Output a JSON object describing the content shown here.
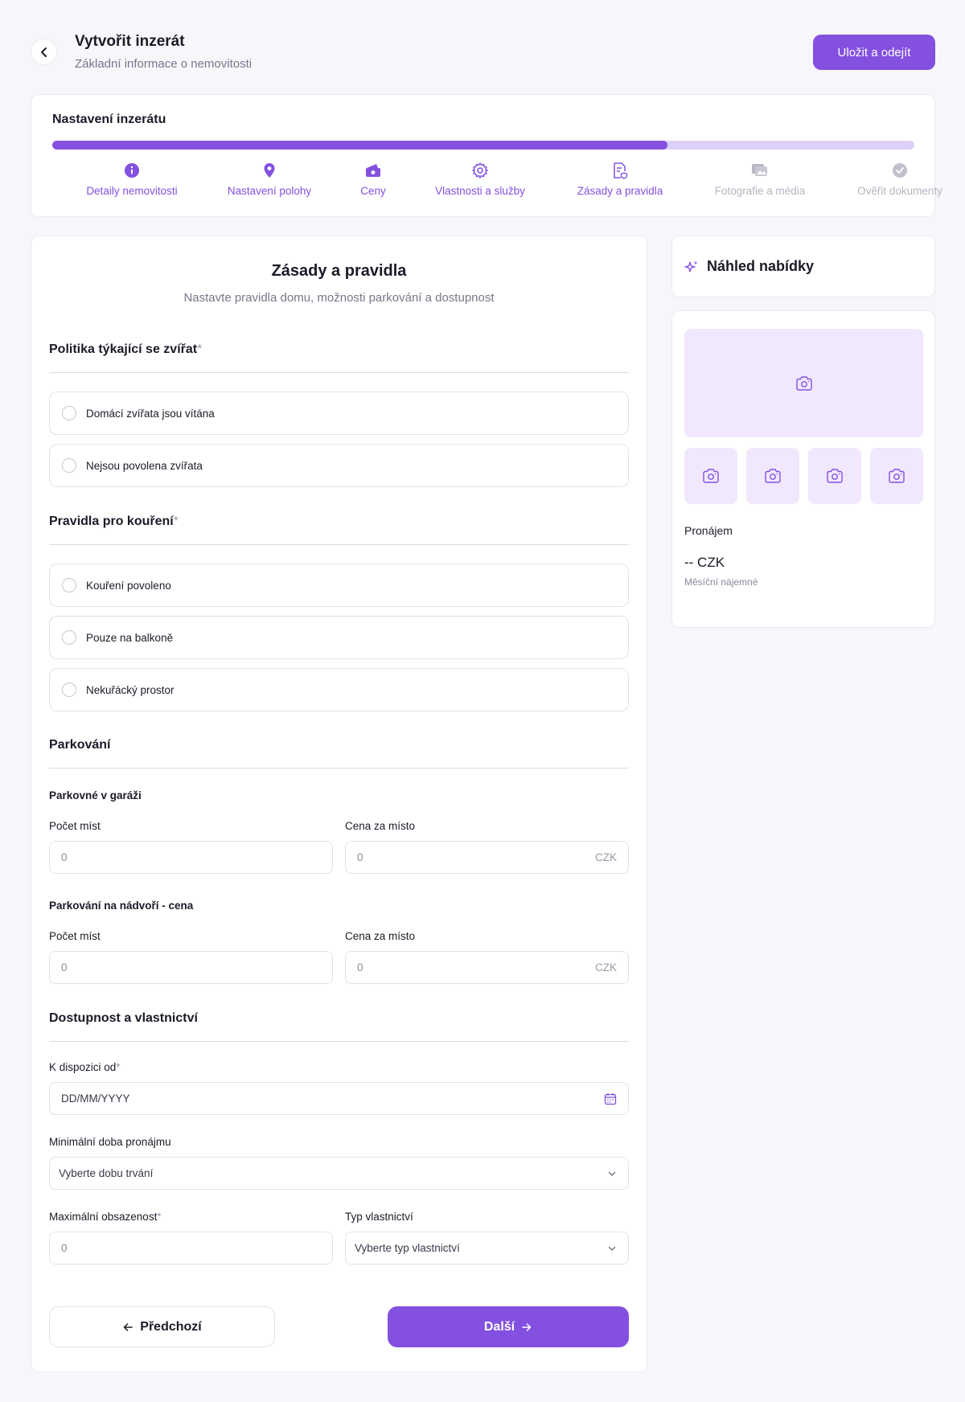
{
  "header": {
    "title": "Vytvořit inzerát",
    "subtitle": "Základní informace o nemovitosti",
    "save_label": "Uložit a odejít"
  },
  "progress": {
    "title": "Nastavení inzerátu",
    "fraction": 0.714,
    "steps": [
      {
        "label": "Detaily nemovitosti",
        "icon": "info-icon",
        "state": "done"
      },
      {
        "label": "Nastavení polohy",
        "icon": "location-pin-icon",
        "state": "done"
      },
      {
        "label": "Ceny",
        "icon": "wallet-icon",
        "state": "done"
      },
      {
        "label": "Vlastnosti a služby",
        "icon": "gear-icon",
        "state": "done"
      },
      {
        "label": "Zásady a pravidla",
        "icon": "rules-document-icon",
        "state": "active"
      },
      {
        "label": "Fotografie a média",
        "icon": "gallery-icon",
        "state": "pending"
      },
      {
        "label": "Ověřit dokumenty",
        "icon": "check-circle-icon",
        "state": "pending"
      }
    ]
  },
  "form": {
    "title": "Zásady a pravidla",
    "subtitle": "Nastavte pravidla domu, možnosti parkování a dostupnost",
    "pets": {
      "title": "Politika týkající se zvířat",
      "required_mark": "*",
      "options": [
        "Domácí zvířata jsou vítána",
        "Nejsou povolena zvířata"
      ]
    },
    "smoking": {
      "title": "Pravidla pro kouření",
      "required_mark": "*",
      "options": [
        "Kouření povoleno",
        "Pouze na balkoně",
        "Nekuřácký prostor"
      ]
    },
    "parking": {
      "title": "Parkování",
      "garage": {
        "label": "Parkovné v garáži",
        "count_label": "Počet míst",
        "count_placeholder": "0",
        "price_label": "Cena za místo",
        "price_placeholder": "0",
        "currency": "CZK"
      },
      "outdoor": {
        "label": "Parkování na nádvoří - cena",
        "count_label": "Počet míst",
        "count_placeholder": "0",
        "price_label": "Cena za místo",
        "price_placeholder": "0",
        "currency": "CZK"
      }
    },
    "availability": {
      "title": "Dostupnost a vlastnictví",
      "available_from_label": "K dispozici od",
      "available_from_required": "*",
      "available_from_placeholder": "DD/MM/YYYY",
      "min_rental_label": "Minimální doba pronájmu",
      "min_rental_value": "Vyberte dobu trvání",
      "max_occupancy_label": "Maximální obsazenost",
      "max_occupancy_required": "*",
      "max_occupancy_placeholder": "0",
      "ownership_label": "Typ vlastnictví",
      "ownership_value": "Vyberte typ vlastnictví"
    },
    "prev_label": "Předchozí",
    "next_label": "Další"
  },
  "preview": {
    "title": "Náhled nabídky",
    "listing_type": "Pronájem",
    "price": "-- CZK",
    "price_note": "Měsíční nájemné"
  },
  "colors": {
    "accent": "#8350e0",
    "accent_light": "#ddd0f7",
    "image_placeholder": "#f1e8fd",
    "background": "#f7f6fb"
  }
}
